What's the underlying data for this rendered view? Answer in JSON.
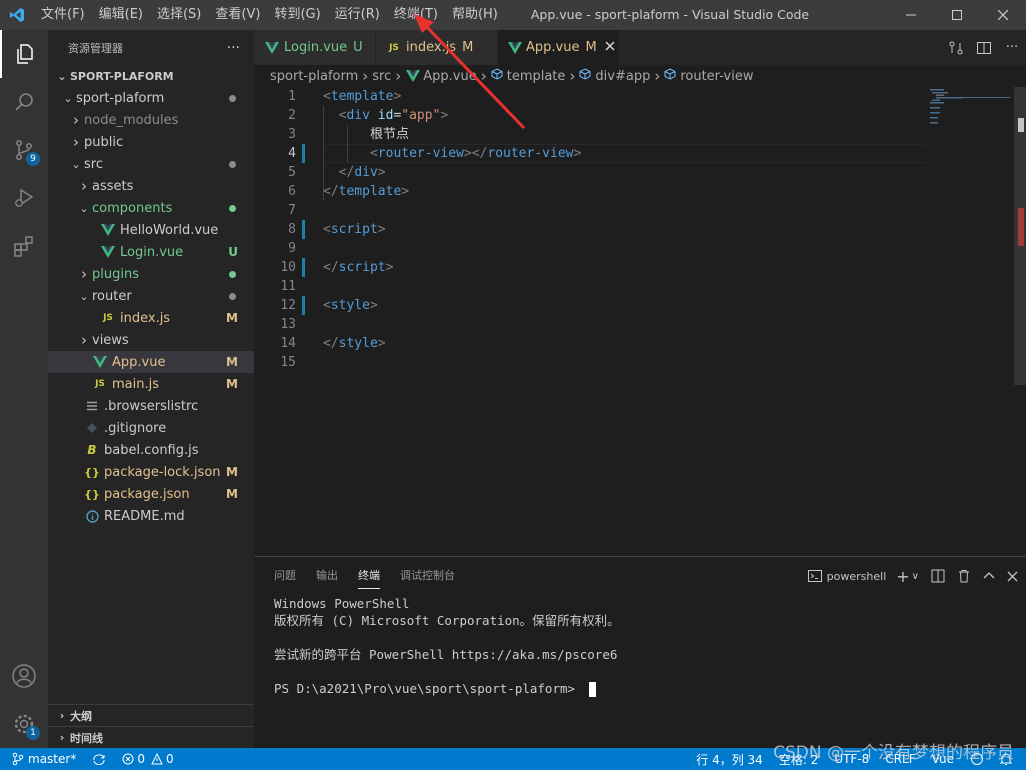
{
  "titlebar": {
    "menu": [
      "文件(F)",
      "编辑(E)",
      "选择(S)",
      "查看(V)",
      "转到(G)",
      "运行(R)",
      "终端(T)",
      "帮助(H)"
    ],
    "window_title": "App.vue - sport-plaform - Visual Studio Code"
  },
  "activitybar": {
    "icons": [
      "explorer-icon",
      "search-icon",
      "source-control-icon",
      "run-debug-icon",
      "extensions-icon",
      "account-icon",
      "manage-icon"
    ],
    "scm_badge": "9",
    "manage_badge": "1"
  },
  "sidebar": {
    "header": "资源管理器",
    "more": "···",
    "project": "SPORT-PLAFORM",
    "tree": [
      {
        "label": "sport-plaform",
        "indent": 1,
        "type": "folder-open",
        "dot": "#8c8c8c"
      },
      {
        "label": "node_modules",
        "indent": 2,
        "type": "folder",
        "muted": true
      },
      {
        "label": "public",
        "indent": 2,
        "type": "folder"
      },
      {
        "label": "src",
        "indent": 2,
        "type": "folder-open",
        "dot": "#8c8c8c"
      },
      {
        "label": "assets",
        "indent": 3,
        "type": "folder"
      },
      {
        "label": "components",
        "indent": 3,
        "type": "folder-open",
        "dot": "#73c991",
        "color": "#73c991"
      },
      {
        "label": "HelloWorld.vue",
        "indent": 4,
        "type": "vue"
      },
      {
        "label": "Login.vue",
        "indent": 4,
        "type": "vue",
        "mark": "U",
        "color": "#73c991"
      },
      {
        "label": "plugins",
        "indent": 3,
        "type": "folder",
        "dot": "#73c991",
        "color": "#73c991"
      },
      {
        "label": "router",
        "indent": 3,
        "type": "folder-open",
        "dot": "#8c8c8c"
      },
      {
        "label": "index.js",
        "indent": 4,
        "type": "js",
        "mark": "M",
        "color": "#e2c08d"
      },
      {
        "label": "views",
        "indent": 3,
        "type": "folder"
      },
      {
        "label": "App.vue",
        "indent": 3,
        "type": "vue",
        "mark": "M",
        "color": "#e2c08d",
        "selected": true
      },
      {
        "label": "main.js",
        "indent": 3,
        "type": "js",
        "mark": "M",
        "color": "#e2c08d"
      },
      {
        "label": ".browserslistrc",
        "indent": 2,
        "type": "lines"
      },
      {
        "label": ".gitignore",
        "indent": 2,
        "type": "git"
      },
      {
        "label": "babel.config.js",
        "indent": 2,
        "type": "babel"
      },
      {
        "label": "package-lock.json",
        "indent": 2,
        "type": "json",
        "mark": "M",
        "color": "#e2c08d"
      },
      {
        "label": "package.json",
        "indent": 2,
        "type": "json",
        "mark": "M",
        "color": "#e2c08d"
      },
      {
        "label": "README.md",
        "indent": 2,
        "type": "info"
      }
    ],
    "outline": "大纲",
    "timeline": "时间线"
  },
  "tabs": [
    {
      "label": "Login.vue",
      "suffix": "U",
      "icon": "vue",
      "color": "#73c991",
      "active": false
    },
    {
      "label": "index.js",
      "suffix": "M",
      "icon": "js",
      "color": "#e2c08d",
      "active": false
    },
    {
      "label": "App.vue",
      "suffix": "M",
      "icon": "vue",
      "color": "#e2c08d",
      "active": true
    }
  ],
  "breadcrumb": [
    "sport-plaform",
    "src",
    "App.vue",
    "template",
    "div#app",
    "router-view"
  ],
  "code": {
    "current_line": 4,
    "lines": [
      [
        [
          "t-punc",
          "<"
        ],
        [
          "t-tag",
          "template"
        ],
        [
          "t-punc",
          ">"
        ]
      ],
      [
        [
          "t-text",
          "  "
        ],
        [
          "t-punc",
          "<"
        ],
        [
          "t-tag",
          "div"
        ],
        [
          "t-text",
          " "
        ],
        [
          "t-attr",
          "id"
        ],
        [
          "t-text",
          "="
        ],
        [
          "t-str",
          "\"app\""
        ],
        [
          "t-punc",
          ">"
        ]
      ],
      [
        [
          "t-text",
          "      根节点"
        ]
      ],
      [
        [
          "t-text",
          "      "
        ],
        [
          "t-punc",
          "<"
        ],
        [
          "t-tag",
          "router-view"
        ],
        [
          "t-punc",
          "></"
        ],
        [
          "t-tag",
          "router-view"
        ],
        [
          "t-punc",
          ">"
        ]
      ],
      [
        [
          "t-text",
          "  "
        ],
        [
          "t-punc",
          "</"
        ],
        [
          "t-tag",
          "div"
        ],
        [
          "t-punc",
          ">"
        ]
      ],
      [
        [
          "t-punc",
          "</"
        ],
        [
          "t-tag",
          "template"
        ],
        [
          "t-punc",
          ">"
        ]
      ],
      [],
      [
        [
          "t-punc",
          "<"
        ],
        [
          "t-tag",
          "script"
        ],
        [
          "t-punc",
          ">"
        ]
      ],
      [],
      [
        [
          "t-punc",
          "</"
        ],
        [
          "t-tag",
          "script"
        ],
        [
          "t-punc",
          ">"
        ]
      ],
      [],
      [
        [
          "t-punc",
          "<"
        ],
        [
          "t-tag",
          "style"
        ],
        [
          "t-punc",
          ">"
        ]
      ],
      [],
      [
        [
          "t-punc",
          "</"
        ],
        [
          "t-tag",
          "style"
        ],
        [
          "t-punc",
          ">"
        ]
      ],
      []
    ],
    "modified_lines": [
      4,
      8,
      10,
      12
    ]
  },
  "panel": {
    "tabs": [
      "问题",
      "输出",
      "终端",
      "调试控制台"
    ],
    "active_tab": 2,
    "shell": "powershell",
    "terminal_lines": [
      "Windows PowerShell",
      "版权所有 (C) Microsoft Corporation。保留所有权利。",
      "",
      "尝试新的跨平台 PowerShell https://aka.ms/pscore6",
      "",
      "PS D:\\a2021\\Pro\\vue\\sport\\sport-plaform> "
    ]
  },
  "statusbar": {
    "branch": "master*",
    "sync": "",
    "errors": "0",
    "warnings": "0",
    "position": "行 4，列 34",
    "spaces": "空格: 2",
    "encoding": "UTF-8",
    "eol": "CRLF",
    "language": "Vue"
  },
  "watermark": "CSDN @一个没有梦想的程序员",
  "colors": {
    "accent": "#007acc",
    "vue_green": "#41b883",
    "js_yellow": "#cbcb41",
    "annotation_red": "#e8322d"
  }
}
